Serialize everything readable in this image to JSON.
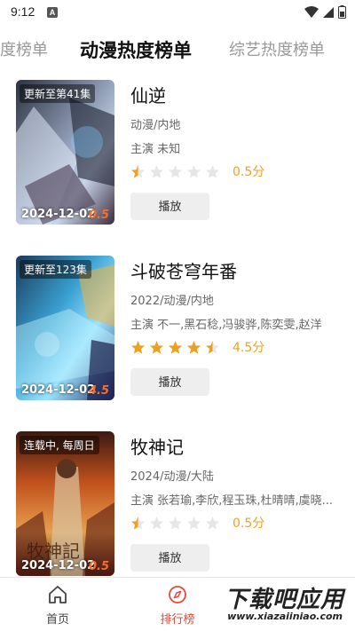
{
  "status": {
    "time": "9:12",
    "notif": "A"
  },
  "tabs": {
    "left": "热度榜单",
    "center": "动漫热度榜单",
    "right": "综艺热度榜单"
  },
  "items": [
    {
      "badge": "更新至第41集",
      "date": "2024-12-02",
      "poster_score": "0.5",
      "title": "仙逆",
      "meta": "动漫/内地",
      "cast": "主演 未知",
      "rating": 0.5,
      "score": "0.5分",
      "play": "播放"
    },
    {
      "badge": "更新至123集",
      "date": "2024-12-02",
      "poster_score": "4.5",
      "title": "斗破苍穹年番",
      "meta": "2022/动漫/内地",
      "cast": "主演 不一,黑石稔,冯骏骅,陈奕雯,赵洋",
      "rating": 4.5,
      "score": "4.5分",
      "play": "播放"
    },
    {
      "badge": "连载中, 每周日",
      "date": "2024-12-02",
      "poster_score": "0.5",
      "title": "牧神记",
      "meta": "2024/动漫/大陆",
      "cast": "主演 张若瑜,李欣,程玉珠,杜晴晴,虞晓...",
      "rating": 0.5,
      "score": "0.5分",
      "play": "播放"
    }
  ],
  "nav": {
    "home": "首页",
    "rank": "排行榜"
  },
  "watermark": {
    "main": "下载吧应用",
    "sub": "www.xiazaiiniao.com"
  },
  "colors": {
    "accent": "#e8473a",
    "star": "#f0a020",
    "star_empty": "#e6e6e6"
  }
}
